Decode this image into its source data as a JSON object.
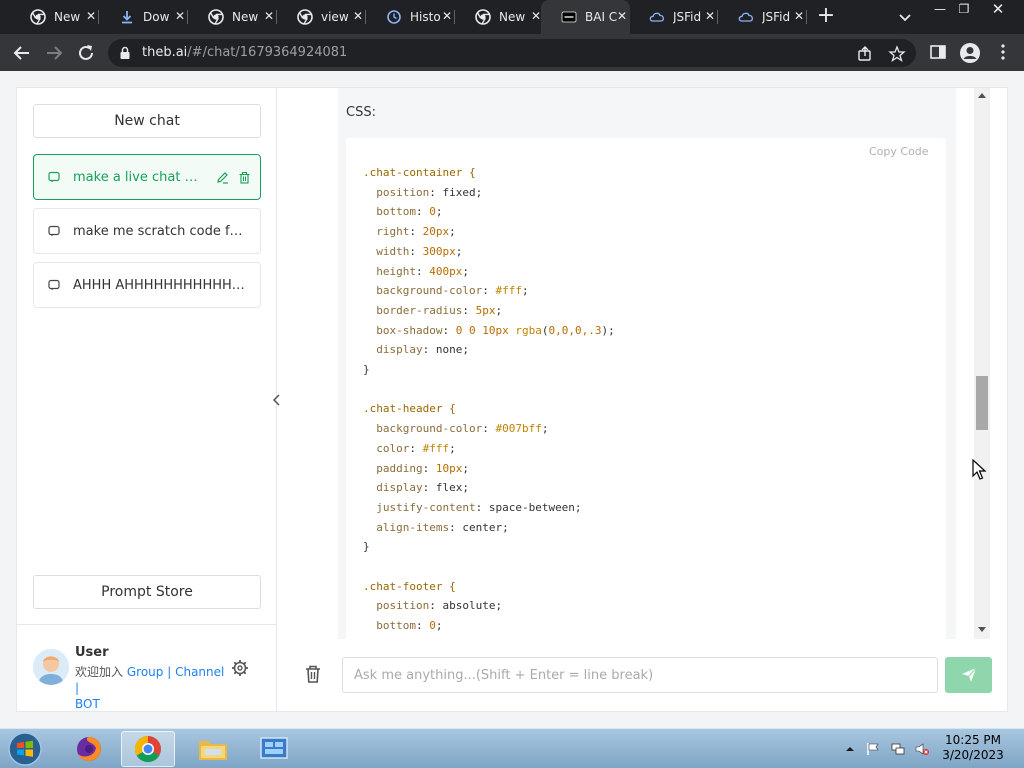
{
  "browser": {
    "tabs": [
      {
        "title": "New",
        "icon": "chrome-icon",
        "active": false
      },
      {
        "title": "Dow",
        "icon": "download-icon",
        "active": false
      },
      {
        "title": "New",
        "icon": "chrome-icon",
        "active": false
      },
      {
        "title": "view",
        "icon": "chrome-icon",
        "active": false
      },
      {
        "title": "Histo",
        "icon": "history-icon",
        "active": false
      },
      {
        "title": "New",
        "icon": "chrome-icon",
        "active": false
      },
      {
        "title": "BAI C",
        "icon": "bai-icon",
        "active": true
      },
      {
        "title": "JSFid",
        "icon": "jsfiddle-icon",
        "active": false
      },
      {
        "title": "JSFid",
        "icon": "jsfiddle-icon",
        "active": false
      }
    ],
    "url_host": "theb.ai",
    "url_path": "/#/chat/1679364924081"
  },
  "sidebar": {
    "new_chat_label": "New chat",
    "chats": [
      {
        "title": "make a live chat with html css and js",
        "active": true
      },
      {
        "title": "make me scratch code for a game",
        "active": false
      },
      {
        "title": "AHHH AHHHHHHHHHHHHHHHHHHHHH",
        "active": false
      }
    ],
    "prompt_store_label": "Prompt Store",
    "user": {
      "name": "User",
      "welcome": "欢迎加入",
      "group_link": "Group",
      "channel_link": "Channel",
      "bot_link": "BOT",
      "separator": "|"
    }
  },
  "message": {
    "label": "CSS:",
    "copy_label": "Copy  Code",
    "code_lines": [
      [
        [
          "sel",
          ".chat-container {"
        ]
      ],
      [
        [
          "prop",
          "  position"
        ],
        [
          "val",
          ": fixed;"
        ]
      ],
      [
        [
          "prop",
          "  bottom"
        ],
        [
          "val",
          ": "
        ],
        [
          "num",
          "0"
        ],
        [
          "val",
          ";"
        ]
      ],
      [
        [
          "prop",
          "  right"
        ],
        [
          "val",
          ": "
        ],
        [
          "num",
          "20px"
        ],
        [
          "val",
          ";"
        ]
      ],
      [
        [
          "prop",
          "  width"
        ],
        [
          "val",
          ": "
        ],
        [
          "num",
          "300px"
        ],
        [
          "val",
          ";"
        ]
      ],
      [
        [
          "prop",
          "  height"
        ],
        [
          "val",
          ": "
        ],
        [
          "num",
          "400px"
        ],
        [
          "val",
          ";"
        ]
      ],
      [
        [
          "prop",
          "  background-color"
        ],
        [
          "val",
          ": "
        ],
        [
          "hex",
          "#fff"
        ],
        [
          "val",
          ";"
        ]
      ],
      [
        [
          "prop",
          "  border-radius"
        ],
        [
          "val",
          ": "
        ],
        [
          "num",
          "5px"
        ],
        [
          "val",
          ";"
        ]
      ],
      [
        [
          "prop",
          "  box-shadow"
        ],
        [
          "val",
          ": "
        ],
        [
          "num",
          "0 0 10px"
        ],
        [
          "val",
          " "
        ],
        [
          "hex",
          "rgba"
        ],
        [
          "val",
          "("
        ],
        [
          "num",
          "0,0,0,.3"
        ],
        [
          "val",
          ");"
        ]
      ],
      [
        [
          "prop",
          "  display"
        ],
        [
          "val",
          ": none;"
        ]
      ],
      [
        [
          "val",
          "}"
        ]
      ],
      [
        [
          "val",
          ""
        ]
      ],
      [
        [
          "sel",
          ".chat-header {"
        ]
      ],
      [
        [
          "prop",
          "  background-color"
        ],
        [
          "val",
          ": "
        ],
        [
          "hex",
          "#007bff"
        ],
        [
          "val",
          ";"
        ]
      ],
      [
        [
          "prop",
          "  color"
        ],
        [
          "val",
          ": "
        ],
        [
          "hex",
          "#fff"
        ],
        [
          "val",
          ";"
        ]
      ],
      [
        [
          "prop",
          "  padding"
        ],
        [
          "val",
          ": "
        ],
        [
          "num",
          "10px"
        ],
        [
          "val",
          ";"
        ]
      ],
      [
        [
          "prop",
          "  display"
        ],
        [
          "val",
          ": flex;"
        ]
      ],
      [
        [
          "prop",
          "  justify-content"
        ],
        [
          "val",
          ": space-between;"
        ]
      ],
      [
        [
          "prop",
          "  align-items"
        ],
        [
          "val",
          ": center;"
        ]
      ],
      [
        [
          "val",
          "}"
        ]
      ],
      [
        [
          "val",
          ""
        ]
      ],
      [
        [
          "sel",
          ".chat-footer {"
        ]
      ],
      [
        [
          "prop",
          "  position"
        ],
        [
          "val",
          ": absolute;"
        ]
      ],
      [
        [
          "prop",
          "  bottom"
        ],
        [
          "val",
          ": "
        ],
        [
          "num",
          "0"
        ],
        [
          "val",
          ";"
        ]
      ]
    ]
  },
  "input": {
    "placeholder": "Ask me anything...(Shift + Enter = line break)"
  },
  "taskbar": {
    "time": "10:25 PM",
    "date": "3/20/2023"
  },
  "colors": {
    "accent": "#18a058",
    "send_button": "#8fd6ad",
    "link": "#2080f0"
  }
}
